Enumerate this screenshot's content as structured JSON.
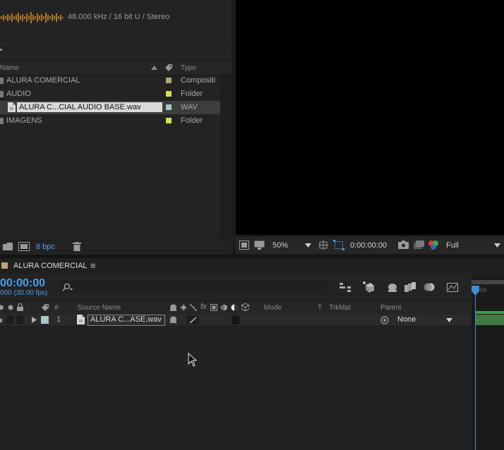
{
  "project": {
    "audio_info": "48.000 kHz / 16 bit U / Stereo",
    "columns": {
      "name": "Name",
      "type": "Type"
    },
    "items": [
      {
        "name": "ALURA COMERCIAL",
        "type": "Compositi",
        "color": "#b8a47a"
      },
      {
        "name": "AUDIO",
        "type": "Folder",
        "color": "#d8e04c"
      },
      {
        "name": "ALURA C...CIAL AUDIO BASE.wav",
        "type": "WAV",
        "color": "#a9c6c6"
      },
      {
        "name": "IMAGENS",
        "type": "Folder",
        "color": "#d8e04c"
      }
    ],
    "bpc": "8 bpc"
  },
  "viewer": {
    "zoom": "50%",
    "timecode": "0:00:00:00",
    "resolution": "Full"
  },
  "timeline": {
    "tab_title": "ALURA COMERCIAL",
    "menu_icon": "≡",
    "timecode": "00:00:00",
    "fps": "000 (30.00 fps)",
    "columns": {
      "number": "#",
      "source_name": "Source Name",
      "mode": "Mode",
      "t": "T",
      "trkmat": "TrkMat",
      "parent": "Parent"
    },
    "layers": [
      {
        "number": "1",
        "source_name": "ALURA C...ASE.wav",
        "parent": "None"
      }
    ],
    "ruler_label": "0s"
  },
  "colors": {
    "accent": "#4d9fe6",
    "waveform": "#e89a2e",
    "playhead": "#3b8fd6",
    "layer_bar": "#3f7a45"
  }
}
